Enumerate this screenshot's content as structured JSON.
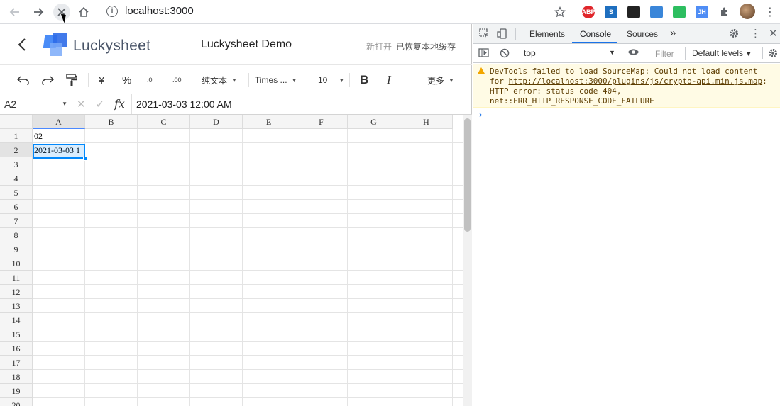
{
  "browser": {
    "url": "localhost:3000",
    "extensions": [
      {
        "name": "abp-icon",
        "label": "ABP",
        "color": "#e0262b"
      },
      {
        "name": "s-ext-icon",
        "label": "S",
        "color": "#1f6fbf"
      },
      {
        "name": "cat-ext-icon",
        "label": "",
        "color": "#222222"
      },
      {
        "name": "grid-ext-icon",
        "label": "",
        "color": "#3a86d9"
      },
      {
        "name": "evernote-icon",
        "label": "",
        "color": "#2dbe60"
      },
      {
        "name": "jh-ext-icon",
        "label": "JH",
        "color": "#4f8df5"
      }
    ]
  },
  "app": {
    "brand": "Luckysheet",
    "title": "Luckysheet Demo",
    "status_new": "新打开",
    "status_saved": "已恢复本地缓存"
  },
  "toolbar": {
    "currency": "¥",
    "percent": "%",
    "dec_minus": ".0",
    "dec_plus": ".00",
    "format": "纯文本",
    "font": "Times ...",
    "size": "10",
    "bold": "B",
    "italic": "I",
    "more": "更多"
  },
  "formula_bar": {
    "cell_ref": "A2",
    "fx": "fx",
    "value": "2021-03-03 12:00 AM"
  },
  "grid": {
    "columns": [
      "A",
      "B",
      "C",
      "D",
      "E",
      "F",
      "G",
      "H"
    ],
    "rows": [
      "1",
      "2",
      "3",
      "4",
      "5",
      "6",
      "7",
      "8",
      "9",
      "10",
      "11",
      "12",
      "13",
      "14",
      "15",
      "16",
      "17",
      "18",
      "19",
      "20"
    ],
    "cells": {
      "A1": "02",
      "A2": "2021-03-03 1"
    },
    "selected_col": "A",
    "selected_row": "2"
  },
  "devtools": {
    "tabs": [
      "Elements",
      "Console",
      "Sources"
    ],
    "active_tab": "Console",
    "more_tabs": "»",
    "context": "top",
    "filter_placeholder": "Filter",
    "levels": "Default levels",
    "warning_prefix": "DevTools failed to load SourceMap: Could not load content for ",
    "warning_link": "http://localhost:3000/plugins/js/crypto-api.min.js.map",
    "warning_suffix": ": HTTP error: status code 404, net::ERR_HTTP_RESPONSE_CODE_FAILURE",
    "prompt": "›"
  }
}
